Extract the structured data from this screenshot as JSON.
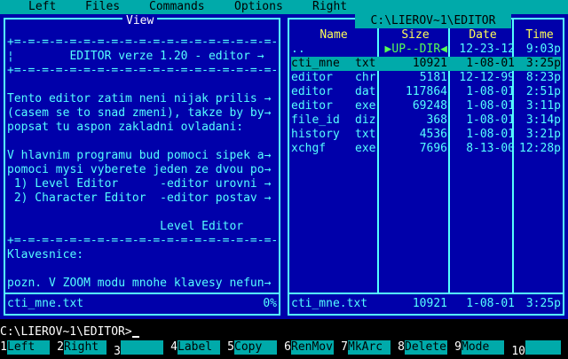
{
  "menu": [
    "Left",
    "Files",
    "Commands",
    "Options",
    "Right"
  ],
  "left_panel": {
    "title": "View",
    "lines": [
      "+=-=-=-=-=-=-=-=-=-=-=-=-=-=-=-=-=-=-=-→",
      "¦        EDITOR verze 1.20 - editor →",
      "+=-=-=-=-=-=-=-=-=-=-=-=-=-=-=-=-=-=-=-→",
      "",
      "Tento editor zatim neni nijak prilis →",
      "(casem se to snad zmeni), takze by by→",
      "popsat tu aspon zakladni ovladani:",
      "",
      "V hlavnim programu bud pomoci sipek a→",
      "pomoci mysi vyberete jeden ze dvou po→",
      " 1) Level Editor      -editor urovni →",
      " 2) Character Editor  -editor postav →",
      "",
      "                      Level Editor",
      "+=-=-=-=-=-=-=-=-=-=-=-=-=-=-=-=-=-=-=-→",
      "Klavesnice:",
      "",
      "pozn. V ZOOM modu mnohe klavesy nefun→"
    ],
    "status_file": "cti_mne.txt",
    "status_percent": "0%"
  },
  "right_panel": {
    "path": "C:\\LIEROV~1\\EDITOR",
    "columns": [
      "Name",
      "Size",
      "Date",
      "Time"
    ],
    "rows": [
      {
        "name": "..",
        "ext": "",
        "size": "▶UP--DIR◀",
        "date": "12-23-12",
        "time": "9:03p"
      },
      {
        "name": "cti_mne",
        "ext": "txt",
        "size": "10921",
        "date": "1-08-01",
        "time": "3:25p"
      },
      {
        "name": "editor",
        "ext": "chr",
        "size": "5181",
        "date": "12-12-99",
        "time": "8:23p"
      },
      {
        "name": "editor",
        "ext": "dat",
        "size": "117864",
        "date": "1-08-01",
        "time": "2:51p"
      },
      {
        "name": "editor",
        "ext": "exe",
        "size": "69248",
        "date": "1-08-01",
        "time": "3:11p"
      },
      {
        "name": "file_id",
        "ext": "diz",
        "size": "368",
        "date": "1-08-01",
        "time": "3:14p"
      },
      {
        "name": "history",
        "ext": "txt",
        "size": "4536",
        "date": "1-08-01",
        "time": "3:21p"
      },
      {
        "name": "xchgf",
        "ext": "exe",
        "size": "7696",
        "date": "8-13-00",
        "time": "12:28p"
      }
    ],
    "status": {
      "name": "cti_mne.txt",
      "size": "10921",
      "date": "1-08-01",
      "time": "3:25p"
    }
  },
  "command_line": "C:\\LIEROV~1\\EDITOR>",
  "fkeys": [
    {
      "num": "1",
      "label": "Left"
    },
    {
      "num": "2",
      "label": "Right"
    },
    {
      "num": "3",
      "label": ""
    },
    {
      "num": "4",
      "label": "Label"
    },
    {
      "num": "5",
      "label": "Copy"
    },
    {
      "num": "6",
      "label": "RenMov"
    },
    {
      "num": "7",
      "label": "MkArc"
    },
    {
      "num": "8",
      "label": "Delete"
    },
    {
      "num": "9",
      "label": "Mode"
    },
    {
      "num": "10",
      "label": ""
    }
  ]
}
